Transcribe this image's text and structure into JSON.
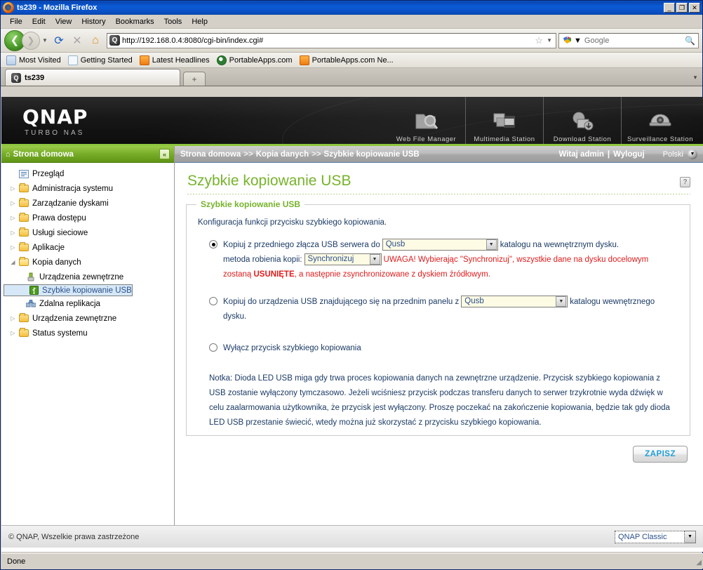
{
  "window": {
    "title": "ts239 - Mozilla Firefox",
    "app_icon": "firefox-icon",
    "minimize": "_",
    "maximize": "❐",
    "close": "✕"
  },
  "menubar": {
    "items": [
      "File",
      "Edit",
      "View",
      "History",
      "Bookmarks",
      "Tools",
      "Help"
    ]
  },
  "toolbar": {
    "back_icon": "back-arrow-icon",
    "forward_icon": "forward-arrow-icon",
    "dropdown_icon": "chevron-down-icon",
    "reload_icon": "reload-icon",
    "stop_icon": "stop-icon",
    "home_icon": "home-icon",
    "url": "http://192.168.0.4:8080/cgi-bin/index.cgi#",
    "url_favicon": "qnap-site-icon",
    "bookmark_star_icon": "star-icon",
    "search_engine": "google-icon",
    "search_placeholder": "Google",
    "search_value": "",
    "search_icon": "magnifier-icon"
  },
  "bookmarks": [
    {
      "label": "Most Visited",
      "icon": "most-visited-icon"
    },
    {
      "label": "Getting Started",
      "icon": "page-icon"
    },
    {
      "label": "Latest Headlines",
      "icon": "rss-icon"
    },
    {
      "label": "PortableApps.com",
      "icon": "portableapps-icon"
    },
    {
      "label": "PortableApps.com Ne...",
      "icon": "rss-icon"
    }
  ],
  "tabs": {
    "active": {
      "label": "ts239",
      "icon": "qnap-site-icon"
    },
    "new_tab_label": "+",
    "list_all_icon": "chevron-down-icon"
  },
  "banner": {
    "logo": "QNAP",
    "tagline": "TURBO NAS",
    "apps": [
      {
        "label": "Web File Manager",
        "icon": "folder-search-icon",
        "glyph": "🗂"
      },
      {
        "label": "Multimedia Station",
        "icon": "photos-film-icon",
        "glyph": "🎞"
      },
      {
        "label": "Download Station",
        "icon": "download-globe-icon",
        "glyph": "🌐"
      },
      {
        "label": "Surveillance Station",
        "icon": "dome-camera-icon",
        "glyph": "📹"
      }
    ]
  },
  "sidebar": {
    "header": "Strona domowa",
    "home_icon": "home-icon",
    "collapse_icon": "collapse-left-icon",
    "items": [
      {
        "label": "Przegląd",
        "icon": "overview-icon",
        "type": "leaf",
        "expandable": false,
        "selected": false,
        "indent": 0
      },
      {
        "label": "Administracja systemu",
        "icon": "folder-icon",
        "type": "folder",
        "expandable": true,
        "selected": false,
        "indent": 0
      },
      {
        "label": "Zarządzanie dyskami",
        "icon": "folder-icon",
        "type": "folder",
        "expandable": true,
        "selected": false,
        "indent": 0
      },
      {
        "label": "Prawa dostępu",
        "icon": "folder-icon",
        "type": "folder",
        "expandable": true,
        "selected": false,
        "indent": 0
      },
      {
        "label": "Usługi sieciowe",
        "icon": "folder-icon",
        "type": "folder",
        "expandable": true,
        "selected": false,
        "indent": 0
      },
      {
        "label": "Aplikacje",
        "icon": "folder-icon",
        "type": "folder",
        "expandable": true,
        "selected": false,
        "indent": 0
      },
      {
        "label": "Kopia danych",
        "icon": "folder-open-icon",
        "type": "folder",
        "expandable": true,
        "selected": false,
        "indent": 0,
        "expanded": true
      },
      {
        "label": "Urządzenia zewnętrzne",
        "icon": "usb-device-icon",
        "type": "leaf",
        "expandable": false,
        "selected": false,
        "indent": 1
      },
      {
        "label": "Szybkie kopiowanie USB",
        "icon": "usb-icon",
        "type": "leaf",
        "expandable": false,
        "selected": true,
        "indent": 1
      },
      {
        "label": "Zdalna replikacja",
        "icon": "replication-icon",
        "type": "leaf",
        "expandable": false,
        "selected": false,
        "indent": 1
      },
      {
        "label": "Urządzenia zewnętrzne",
        "icon": "folder-icon",
        "type": "folder",
        "expandable": true,
        "selected": false,
        "indent": 0
      },
      {
        "label": "Status systemu",
        "icon": "folder-icon",
        "type": "folder",
        "expandable": true,
        "selected": false,
        "indent": 0
      }
    ]
  },
  "breadcrumb": {
    "parts": [
      "Strona domowa",
      "Kopia danych",
      "Szybkie kopiowanie USB"
    ],
    "separator": ">>",
    "welcome": "Witaj admin",
    "divider": "|",
    "logout": "Wyloguj",
    "language": "Polski",
    "language_arrow_icon": "chevron-down-circle-icon"
  },
  "main": {
    "page_title": "Szybkie kopiowanie USB",
    "help_icon": "help-question-icon",
    "help_label": "?",
    "panel_legend": "Szybkie kopiowanie USB",
    "intro": "Konfiguracja funkcji przycisku szybkiego kopiowania.",
    "options": [
      {
        "id": "copy-from-usb",
        "selected": true,
        "text_before": "Kopiuj z przedniego złącza USB serwera do",
        "select_value": "Qusb",
        "text_after": "katalogu na wewnętrznym dysku.",
        "method_label": "metoda robienia kopii:",
        "method_value": "Synchronizuj",
        "warning_1": "UWAGA! Wybierając \"Synchronizuj\", wszystkie dane na dysku docelowym zostaną",
        "warning_bold": "USUNIĘTE",
        "warning_2": ", a następnie zsynchronizowane z dyskiem źródłowym."
      },
      {
        "id": "copy-to-usb",
        "selected": false,
        "text_before": "Kopiuj do urządzenia USB znajdującego się na przednim panelu z",
        "select_value": "Qusb",
        "text_after": "katalogu wewnętrznego dysku."
      },
      {
        "id": "disable-copy",
        "selected": false,
        "text_before": "Wyłącz przycisk szybkiego kopiowania",
        "select_value": "",
        "text_after": ""
      }
    ],
    "note": "Notka: Dioda LED USB miga gdy trwa proces kopiowania danych na zewnętrzne urządzenie. Przycisk szybkiego kopiowania z USB zostanie wyłączony tymczasowo. Jeżeli wciśniesz przycisk podczas transferu danych to serwer trzykrotnie wyda dźwięk w celu zaalarmowania użytkownika, że przycisk jest wyłączony. Proszę poczekać na zakończenie kopiowania, będzie tak gdy dioda LED USB przestanie świecić, wtedy można już skorzystać z przycisku szybkiego kopiowania.",
    "save_button": "ZAPISZ"
  },
  "footer": {
    "copyright": "© QNAP, Wszelkie prawa zastrzeżone",
    "theme_value": "QNAP Classic",
    "theme_arrow_icon": "chevron-down-icon"
  },
  "statusbar": {
    "text": "Done",
    "grip_icon": "resize-grip-icon"
  },
  "colors": {
    "qnap_green": "#76b32b",
    "accent_blue": "#1f9fd8",
    "warning_red": "#e01b1b",
    "body_text": "#1b3a66",
    "titlebar_blue": "#0b5bd6",
    "selection_blue": "#d6e8f7"
  }
}
